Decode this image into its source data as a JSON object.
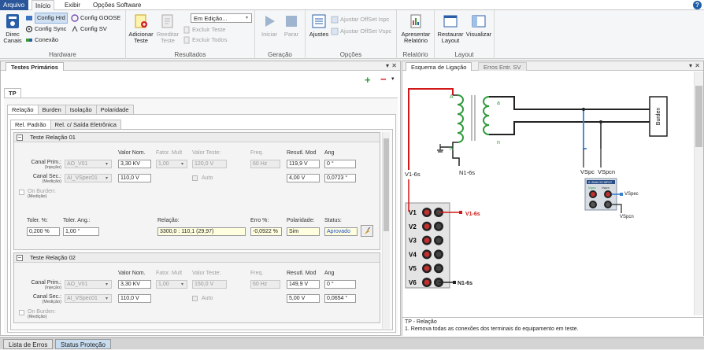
{
  "menu": {
    "items": [
      "Arquivo",
      "Início",
      "Exibir",
      "Opções Software"
    ],
    "help": "?"
  },
  "ribbon": {
    "hardware": {
      "label": "Hardware",
      "direc_canais": "Direc Canais",
      "config_hrd": "Config Hrd",
      "config_goose": "Config GOOSE",
      "config_sync": "Config Sync",
      "config_sv": "Config SV",
      "conexao": "Conexão"
    },
    "resultados": {
      "label": "Resultados",
      "adicionar": "Adicionar Teste",
      "reeditar": "Reeditar Teste",
      "dropdown_value": "Em Edição...",
      "excluir_teste": "Excluir Teste",
      "excluir_todos": "Excluir Todos"
    },
    "geracao": {
      "label": "Geração",
      "iniciar": "Iniciar",
      "parar": "Parar"
    },
    "opcoes": {
      "label": "Opções",
      "ajustes": "Ajustes",
      "offset_ispc": "Ajustar OffSet Ispc",
      "offset_vspc": "Ajustar OffSet Vspc"
    },
    "relatorio": {
      "label": "Relatório",
      "apresentar": "Apresentar Relatório"
    },
    "layout": {
      "label": "Layout",
      "restaurar": "Restaurar Layout",
      "visualizar": "Visualizar"
    }
  },
  "left_panel": {
    "tab": "Testes Primários",
    "tp_tab": "TP",
    "tabs": [
      "Relação",
      "Burden",
      "Isolação",
      "Polaridade"
    ],
    "subtabs": [
      "Rel. Padrão",
      "Rel. c/ Saída Eletrônica"
    ],
    "tests": [
      {
        "title": "Teste Relação 01",
        "col_labels": {
          "valor_nom": "Valor Nom.",
          "fator_mult": "Fator. Mult",
          "valor_teste": "Valor Teste:",
          "freq": "Freq.",
          "result_mod": "Resutl. Mod",
          "ang": "Ang"
        },
        "canal_prim": {
          "label": "Canal Prim.:",
          "sub": "(Injeção)",
          "channel": "AO_V01",
          "valor_nom": "3,30 KV",
          "fator": "1,00",
          "valor_teste": "120,0 V",
          "freq": "60 Hz",
          "mod": "119,9 V",
          "ang": "0 °"
        },
        "canal_sec": {
          "label": "Canal Sec.:",
          "sub": "(Medição)",
          "channel": "AI_VSpec01",
          "valor_nom": "110,0 V",
          "auto": "Auto",
          "mod": "4,00 V",
          "ang": "0,0723 °"
        },
        "on_burden": {
          "label": "On Burden:",
          "sub": "(Medição)"
        },
        "result": {
          "toler_pct_label": "Toler. %:",
          "toler_pct": "0,200 %",
          "toler_ang_label": "Toler. Ang.:",
          "toler_ang": "1,00 °",
          "relacao_label": "Relação:",
          "relacao": "3300,0 : 110,1 (29,97)",
          "erro_label": "Erro %:",
          "erro": "-0,0922 %",
          "polaridade_label": "Polaridade:",
          "polaridade": "Sim",
          "status_label": "Status:",
          "status": "Aprovado"
        }
      },
      {
        "title": "Teste Relação 02",
        "col_labels": {
          "valor_nom": "Valor Nom.",
          "fator_mult": "Fator. Mult",
          "valor_teste": "Valor Teste:",
          "freq": "Freq.",
          "result_mod": "Resutl. Mod",
          "ang": "Ang"
        },
        "canal_prim": {
          "label": "Canal Prim.:",
          "sub": "(Injeção)",
          "channel": "AO_V01",
          "valor_nom": "3,30 KV",
          "fator": "1,00",
          "valor_teste": "150,0 V",
          "freq": "60 Hz",
          "mod": "149,9 V",
          "ang": "0 °"
        },
        "canal_sec": {
          "label": "Canal Sec.:",
          "sub": "(Medição)",
          "channel": "AI_VSpec01",
          "valor_nom": "110,0 V",
          "auto": "Auto",
          "mod": "5,00 V",
          "ang": "0,0654 °"
        },
        "on_burden": {
          "label": "On Burden:",
          "sub": "(Medição)"
        }
      }
    ]
  },
  "right_panel": {
    "tabs": [
      "Esquema de Ligação",
      "Erros Entr. SV"
    ],
    "diagram": {
      "A": "A",
      "a": "a",
      "N": "N",
      "n": "n",
      "v1_6s": "V1-6s",
      "n1_6s": "N1-6s",
      "vspc": "VSpc",
      "vspcn": "VSpcn",
      "burden": "Burden",
      "analog_title": "S. ANALOG INPUT",
      "analog_v1": "Vspec",
      "analog_v2": "Vspcn",
      "analog_out1": "VSpec",
      "analog_out2": "VSpcn",
      "terminals": [
        "V1",
        "V2",
        "V3",
        "V4",
        "V5",
        "V6"
      ],
      "term_v1": "V1-6s",
      "term_v6": "N1-6s"
    },
    "info_title": "TP - Relação",
    "info_text": "1. Remova todas as conexões dos terminais do equipamento em teste."
  },
  "statusbar": {
    "tabs": [
      "Lista de Erros",
      "Status Proteção"
    ]
  },
  "colors": {
    "accent": "#2b579a",
    "red_wire": "#d01818",
    "blue_wire": "#3a7fd0",
    "coil": "#2e9a3c"
  }
}
